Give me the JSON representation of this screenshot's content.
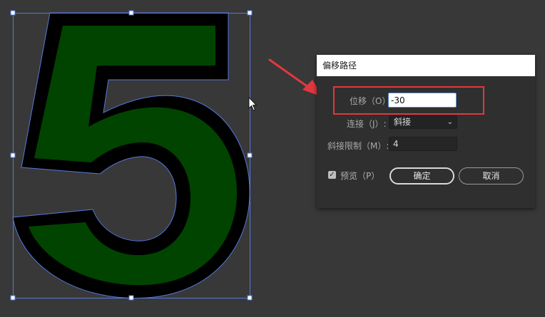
{
  "dialog": {
    "title": "偏移路径",
    "offset": {
      "label": "位移（O）:",
      "value": "-30"
    },
    "joins": {
      "label": "连接（J）:",
      "value": "斜接"
    },
    "miter_limit": {
      "label": "斜接限制（M）:",
      "value": "4"
    },
    "preview": {
      "label": "预览（P）",
      "checked": true
    },
    "ok_label": "确定",
    "cancel_label": "取消"
  },
  "colors": {
    "canvas_bg": "#383838",
    "glyph_fill": "#004400",
    "glyph_outline": "#000000",
    "selection": "#5577dd",
    "annotation": "#e0383e"
  },
  "icons": [
    "chevron-down-icon",
    "checkmark-icon",
    "cursor-arrow-icon",
    "annotation-arrow-icon"
  ]
}
